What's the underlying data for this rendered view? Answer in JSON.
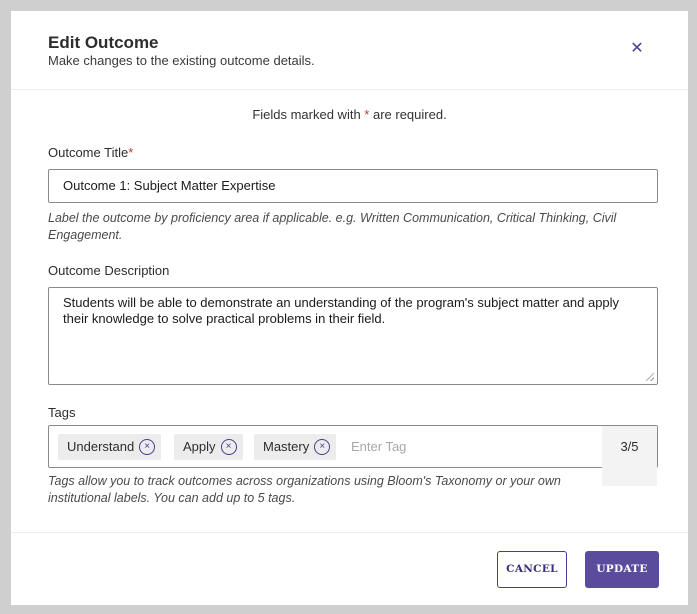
{
  "modal": {
    "title": "Edit Outcome",
    "subtitle": "Make changes to the existing outcome details.",
    "close_icon": "close-icon"
  },
  "required_note": {
    "before": "Fields marked with ",
    "star": "*",
    "after": " are required."
  },
  "outcome_title": {
    "label": "Outcome Title",
    "required_star": "*",
    "value": "Outcome 1: Subject Matter Expertise",
    "help": "Label the outcome by proficiency area if applicable. e.g. Written Communication, Critical Thinking, Civil Engagement."
  },
  "outcome_description": {
    "label": "Outcome Description",
    "value": "Students will be able to demonstrate an understanding of the program's subject matter and apply their knowledge to solve practical problems in their field."
  },
  "tags": {
    "label": "Tags",
    "items": [
      {
        "label": "Understand"
      },
      {
        "label": "Apply"
      },
      {
        "label": "Mastery"
      }
    ],
    "remove_glyph": "×",
    "placeholder": "Enter Tag",
    "count": "3/5",
    "help": "Tags allow you to track outcomes across organizations using Bloom's Taxonomy or your own institutional labels. You can add up to 5 tags."
  },
  "actions": {
    "cancel_label": "CANCEL",
    "update_label": "UPDATE"
  },
  "colors": {
    "accent": "#5b4b9c",
    "required": "#c0392b"
  }
}
